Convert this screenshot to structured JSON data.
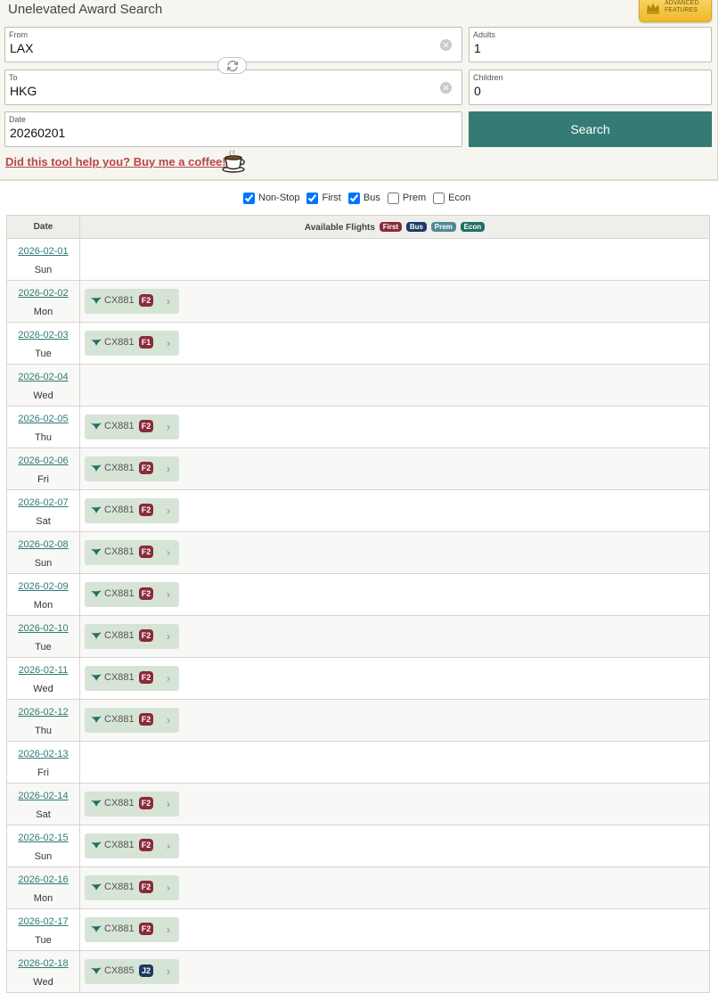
{
  "app": {
    "title": "Unelevated Award Search"
  },
  "advanced": {
    "label": "ADVANCED FEATURES"
  },
  "form": {
    "from": {
      "label": "From",
      "value": "LAX"
    },
    "to": {
      "label": "To",
      "value": "HKG"
    },
    "date": {
      "label": "Date",
      "value": "20260201"
    },
    "adults": {
      "label": "Adults",
      "value": "1"
    },
    "children": {
      "label": "Children",
      "value": "0"
    },
    "search_label": "Search",
    "coffee_text": "Did this tool help you? Buy me a coffee!"
  },
  "filters": [
    {
      "label": "Non-Stop",
      "checked": true
    },
    {
      "label": "First",
      "checked": true
    },
    {
      "label": "Bus",
      "checked": true
    },
    {
      "label": "Prem",
      "checked": false
    },
    {
      "label": "Econ",
      "checked": false
    }
  ],
  "table": {
    "col_date": "Date",
    "col_flights": "Available Flights",
    "class_tags": [
      {
        "label": "First",
        "color": "#8a2a38"
      },
      {
        "label": "Bus",
        "color": "#1c3a63"
      },
      {
        "label": "Prem",
        "color": "#4d8a98"
      },
      {
        "label": "Econ",
        "color": "#1f7065"
      }
    ]
  },
  "colors": {
    "accent": "#357a75",
    "first": "#8a2a38",
    "business": "#1c3a63",
    "chip": "#d6e4d6"
  },
  "rows": [
    {
      "date": "2026-02-01",
      "dow": "Sun",
      "flights": []
    },
    {
      "date": "2026-02-02",
      "dow": "Mon",
      "flights": [
        {
          "number": "CX881",
          "cls": "F2",
          "type": "first"
        }
      ]
    },
    {
      "date": "2026-02-03",
      "dow": "Tue",
      "flights": [
        {
          "number": "CX881",
          "cls": "F1",
          "type": "first"
        }
      ]
    },
    {
      "date": "2026-02-04",
      "dow": "Wed",
      "flights": []
    },
    {
      "date": "2026-02-05",
      "dow": "Thu",
      "flights": [
        {
          "number": "CX881",
          "cls": "F2",
          "type": "first"
        }
      ]
    },
    {
      "date": "2026-02-06",
      "dow": "Fri",
      "flights": [
        {
          "number": "CX881",
          "cls": "F2",
          "type": "first"
        }
      ]
    },
    {
      "date": "2026-02-07",
      "dow": "Sat",
      "flights": [
        {
          "number": "CX881",
          "cls": "F2",
          "type": "first"
        }
      ]
    },
    {
      "date": "2026-02-08",
      "dow": "Sun",
      "flights": [
        {
          "number": "CX881",
          "cls": "F2",
          "type": "first"
        }
      ]
    },
    {
      "date": "2026-02-09",
      "dow": "Mon",
      "flights": [
        {
          "number": "CX881",
          "cls": "F2",
          "type": "first"
        }
      ]
    },
    {
      "date": "2026-02-10",
      "dow": "Tue",
      "flights": [
        {
          "number": "CX881",
          "cls": "F2",
          "type": "first"
        }
      ]
    },
    {
      "date": "2026-02-11",
      "dow": "Wed",
      "flights": [
        {
          "number": "CX881",
          "cls": "F2",
          "type": "first"
        }
      ]
    },
    {
      "date": "2026-02-12",
      "dow": "Thu",
      "flights": [
        {
          "number": "CX881",
          "cls": "F2",
          "type": "first"
        }
      ]
    },
    {
      "date": "2026-02-13",
      "dow": "Fri",
      "flights": []
    },
    {
      "date": "2026-02-14",
      "dow": "Sat",
      "flights": [
        {
          "number": "CX881",
          "cls": "F2",
          "type": "first"
        }
      ]
    },
    {
      "date": "2026-02-15",
      "dow": "Sun",
      "flights": [
        {
          "number": "CX881",
          "cls": "F2",
          "type": "first"
        }
      ]
    },
    {
      "date": "2026-02-16",
      "dow": "Mon",
      "flights": [
        {
          "number": "CX881",
          "cls": "F2",
          "type": "first"
        }
      ]
    },
    {
      "date": "2026-02-17",
      "dow": "Tue",
      "flights": [
        {
          "number": "CX881",
          "cls": "F2",
          "type": "first"
        }
      ]
    },
    {
      "date": "2026-02-18",
      "dow": "Wed",
      "flights": [
        {
          "number": "CX885",
          "cls": "J2",
          "type": "business"
        }
      ]
    }
  ]
}
